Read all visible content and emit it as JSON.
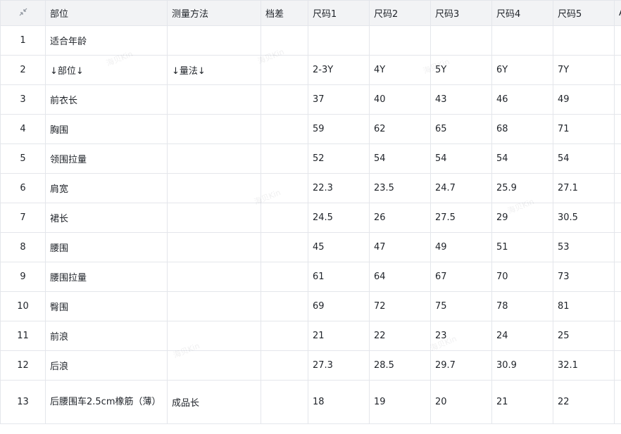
{
  "table": {
    "columns": [
      "部位",
      "测量方法",
      "档差",
      "尺码1",
      "尺码2",
      "尺码3",
      "尺码4",
      "尺码5",
      "A"
    ],
    "rows": [
      {
        "num": "1",
        "cells": [
          "适合年龄",
          "",
          "",
          "",
          "",
          "",
          "",
          "",
          ""
        ]
      },
      {
        "num": "2",
        "cells": [
          "↓部位↓",
          "↓量法↓",
          "",
          "2-3Y",
          "4Y",
          "5Y",
          "6Y",
          "7Y",
          ""
        ]
      },
      {
        "num": "3",
        "cells": [
          "前衣长",
          "",
          "",
          "37",
          "40",
          "43",
          "46",
          "49",
          ""
        ]
      },
      {
        "num": "4",
        "cells": [
          "胸围",
          "",
          "",
          "59",
          "62",
          "65",
          "68",
          "71",
          ""
        ]
      },
      {
        "num": "5",
        "cells": [
          "领围拉量",
          "",
          "",
          "52",
          "54",
          "54",
          "54",
          "54",
          ""
        ]
      },
      {
        "num": "6",
        "cells": [
          "肩宽",
          "",
          "",
          "22.3",
          "23.5",
          "24.7",
          "25.9",
          "27.1",
          ""
        ]
      },
      {
        "num": "7",
        "cells": [
          "裙长",
          "",
          "",
          "24.5",
          "26",
          "27.5",
          "29",
          "30.5",
          ""
        ]
      },
      {
        "num": "8",
        "cells": [
          "腰围",
          "",
          "",
          "45",
          "47",
          "49",
          "51",
          "53",
          ""
        ]
      },
      {
        "num": "9",
        "cells": [
          "腰围拉量",
          "",
          "",
          "61",
          "64",
          "67",
          "70",
          "73",
          ""
        ]
      },
      {
        "num": "10",
        "cells": [
          "臀围",
          "",
          "",
          "69",
          "72",
          "75",
          "78",
          "81",
          ""
        ]
      },
      {
        "num": "11",
        "cells": [
          "前浪",
          "",
          "",
          "21",
          "22",
          "23",
          "24",
          "25",
          ""
        ]
      },
      {
        "num": "12",
        "cells": [
          "后浪",
          "",
          "",
          "27.3",
          "28.5",
          "29.7",
          "30.9",
          "32.1",
          ""
        ]
      },
      {
        "num": "13",
        "cells": [
          "后腰围车2.5cm橡筋（薄）",
          "成品长",
          "",
          "18",
          "19",
          "20",
          "21",
          "22",
          ""
        ]
      }
    ]
  },
  "watermark": "海贝Kin",
  "icons": {
    "corner": "collapse-arrows-icon"
  }
}
